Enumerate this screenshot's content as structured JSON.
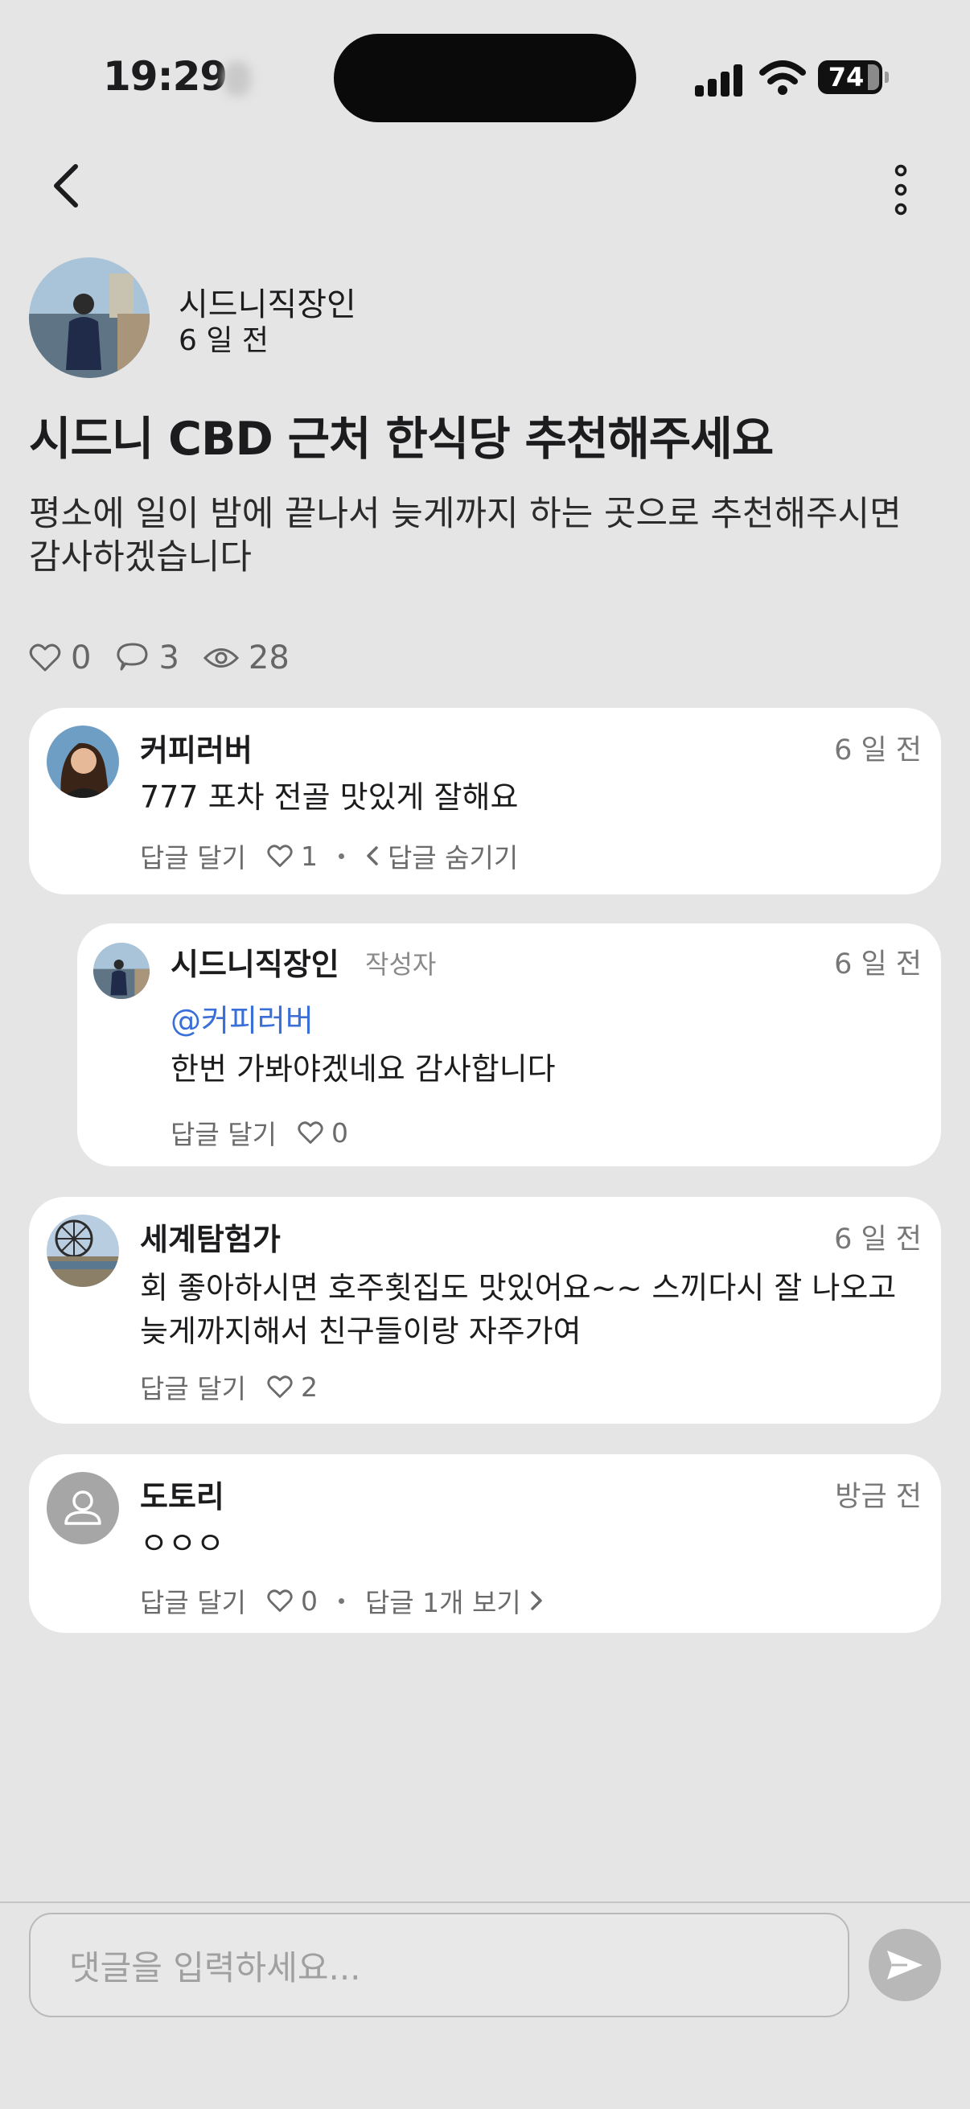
{
  "status_bar": {
    "time": "19:29",
    "battery": "74"
  },
  "nav": {
    "back_icon": "chevron-left-icon",
    "more_icon": "more-vertical-icon"
  },
  "post": {
    "author": "시드니직장인",
    "time": "6 일 전",
    "title": "시드니 CBD 근처 한식당 추천해주세요",
    "body_line1": "평소에 일이 밤에 끝나서 늦게까지 하는 곳으로 추천해주시면",
    "body_line2": "감사하겠습니다",
    "likes": "0",
    "comments": "3",
    "views": "28"
  },
  "comments": [
    {
      "name": "커피러버",
      "time": "6 일 전",
      "text": "777 포차 전골 맛있게 잘해요",
      "reply_label": "답글 달기",
      "likes": "1",
      "toggle_label": "답글 숨기기"
    },
    {
      "name": "시드니직장인",
      "badge": "작성자",
      "time": "6 일 전",
      "mention": "@커피러버",
      "text": "한번 가봐야겠네요 감사합니다",
      "reply_label": "답글 달기",
      "likes": "0"
    },
    {
      "name": "세계탐험가",
      "time": "6 일 전",
      "text_line1": "회 좋아하시면 호주횟집도 맛있어요~~ 스끼다시 잘 나오고",
      "text_line2": "늦게까지해서 친구들이랑 자주가여",
      "reply_label": "답글 달기",
      "likes": "2"
    },
    {
      "name": "도토리",
      "time": "방금 전",
      "text": "ㅇㅇㅇ",
      "reply_label": "답글 달기",
      "likes": "0",
      "toggle_label": "답글 1개 보기"
    }
  ],
  "composer": {
    "placeholder": "댓글을 입력하세요...",
    "send_icon": "send-icon"
  },
  "colors": {
    "background": "#e5e5e5",
    "card": "#ffffff",
    "mention": "#3a6fd8",
    "send_button": "#b8b8b8"
  }
}
